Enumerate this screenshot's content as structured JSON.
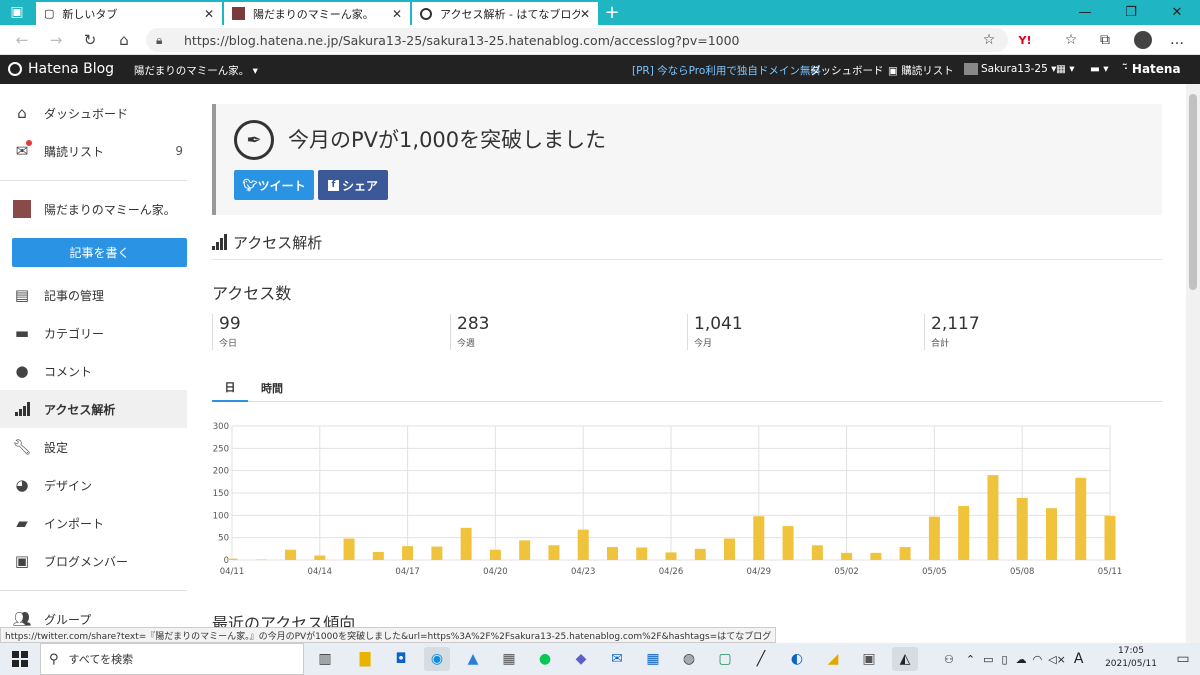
{
  "browser": {
    "tabs": [
      {
        "title": "新しいタブ"
      },
      {
        "title": "陽だまりのマミーん家。"
      },
      {
        "title": "アクセス解析 - はてなブログ"
      }
    ],
    "url": "https://blog.hatena.ne.jp/Sakura13-25/sakura13-25.hatenablog.com/accesslog?pv=1000"
  },
  "header": {
    "logo": "Hatena Blog",
    "blog_name": "陽だまりのマミーん家。 ▾",
    "promo": "[PR] 今ならPro利用で独自ドメイン無料",
    "dashboard": "ダッシュボード",
    "reading_list": "購読リスト",
    "user": "Sakura13-25 ▾",
    "hatena": "Hatena"
  },
  "sidebar": {
    "top_items": [
      {
        "label": "ダッシュボード",
        "icon": "home-icon"
      },
      {
        "label": "購読リスト",
        "icon": "mail-icon",
        "count": "9"
      }
    ],
    "blog_name": "陽だまりのマミーん家。",
    "write_button": "記事を書く",
    "items": [
      {
        "label": "記事の管理",
        "icon": "document-icon"
      },
      {
        "label": "カテゴリー",
        "icon": "folder-icon"
      },
      {
        "label": "コメント",
        "icon": "comment-icon"
      },
      {
        "label": "アクセス解析",
        "icon": "signal-icon",
        "active": true
      },
      {
        "label": "設定",
        "icon": "wrench-icon"
      },
      {
        "label": "デザイン",
        "icon": "palette-icon"
      },
      {
        "label": "インポート",
        "icon": "truck-icon"
      },
      {
        "label": "ブログメンバー",
        "icon": "member-icon"
      },
      {
        "label": "グループ",
        "icon": "group-icon"
      }
    ]
  },
  "main": {
    "banner_title": "今月のPVが1,000を突破しました",
    "tweet_button": "ツイート",
    "share_button": "シェア",
    "section_title": "アクセス解析",
    "access_title": "アクセス数",
    "stats": [
      {
        "value": "99",
        "label": "今日"
      },
      {
        "value": "283",
        "label": "今週"
      },
      {
        "value": "1,041",
        "label": "今月"
      },
      {
        "value": "2,117",
        "label": "合計"
      }
    ],
    "period_tabs": [
      {
        "label": "日",
        "active": true
      },
      {
        "label": "時間",
        "active": false
      }
    ],
    "recent_title": "最近のアクセス傾向"
  },
  "chart_data": {
    "type": "bar",
    "categories": [
      "04/11",
      "04/12",
      "04/13",
      "04/14",
      "04/15",
      "04/16",
      "04/17",
      "04/18",
      "04/19",
      "04/20",
      "04/21",
      "04/22",
      "04/23",
      "04/24",
      "04/25",
      "04/26",
      "04/27",
      "04/28",
      "04/29",
      "04/30",
      "05/01",
      "05/02",
      "05/03",
      "05/04",
      "05/05",
      "05/06",
      "05/07",
      "05/08",
      "05/09",
      "05/10",
      "05/11"
    ],
    "values": [
      3,
      1,
      23,
      10,
      48,
      18,
      31,
      30,
      72,
      23,
      44,
      33,
      68,
      29,
      28,
      17,
      25,
      48,
      98,
      76,
      33,
      16,
      16,
      29,
      97,
      121,
      190,
      139,
      116,
      184,
      99
    ],
    "ylim": [
      0,
      300
    ],
    "yticks": [
      0,
      50,
      100,
      150,
      200,
      250,
      300
    ],
    "xticks": [
      "04/11",
      "04/14",
      "04/17",
      "04/20",
      "04/23",
      "04/26",
      "04/29",
      "05/02",
      "05/05",
      "05/08",
      "05/11"
    ],
    "color": "#f0c33c",
    "grid": true
  },
  "status_url": "https://twitter.com/share?text=『陽だまりのマミーん家。』の今月のPVが1000を突破しました&url=https%3A%2F%2Fsakura13-25.hatenablog.com%2F&hashtags=はてなブログ",
  "taskbar": {
    "search_placeholder": "すべてを検索",
    "ime": "A",
    "time": "17:05",
    "date": "2021/05/11"
  }
}
